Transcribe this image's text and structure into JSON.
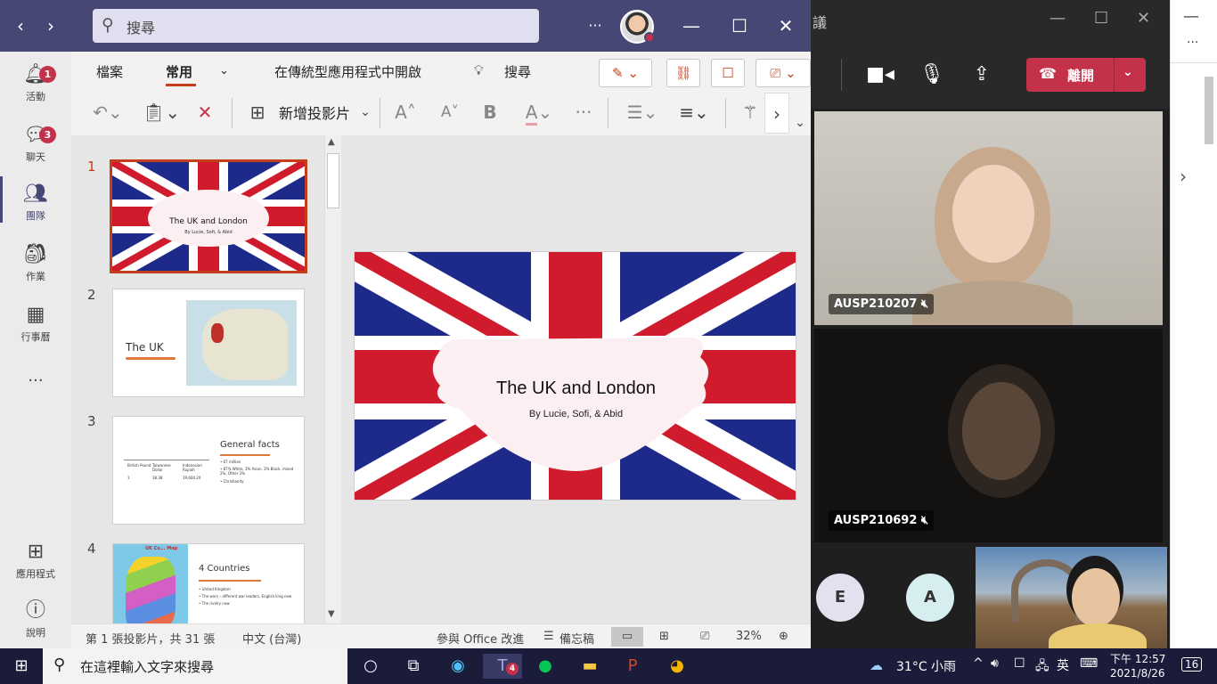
{
  "teams": {
    "search_placeholder": "搜尋",
    "more_label": "···",
    "window": {
      "minimize": "—",
      "maximize": "☐",
      "close": "✕"
    }
  },
  "rail": {
    "items": [
      {
        "id": "activity",
        "label": "活動",
        "icon": "bell-icon",
        "badge": "1"
      },
      {
        "id": "chat",
        "label": "聊天",
        "icon": "chat-icon",
        "badge": "3"
      },
      {
        "id": "teams",
        "label": "團隊",
        "icon": "teams-icon",
        "active": true
      },
      {
        "id": "assignments",
        "label": "作業",
        "icon": "backpack-icon"
      },
      {
        "id": "calendar",
        "label": "行事曆",
        "icon": "calendar-icon"
      },
      {
        "id": "more",
        "label": "···",
        "icon": "ellipsis-icon"
      },
      {
        "id": "apps",
        "label": "應用程式",
        "icon": "apps-icon"
      },
      {
        "id": "help",
        "label": "說明",
        "icon": "help-icon"
      }
    ]
  },
  "ribbon": {
    "tabs": [
      "檔案",
      "常用"
    ],
    "open_desktop": "在傳統型應用程式中開啟",
    "tell_me": "搜尋",
    "new_slide": "新增投影片"
  },
  "slides": {
    "thumb1": {
      "title": "The UK and London",
      "subtitle": "By Lucie, Sofi, & Abid"
    },
    "thumb2": {
      "title": "The UK"
    },
    "thumb3": {
      "title": "General facts",
      "table_headers": [
        "British Pound",
        "Taiwanese Dollar",
        "Indonesian Rupiah"
      ],
      "table_values": [
        "1",
        "38.38",
        "19,600.20"
      ],
      "bullets": [
        "• 67 million",
        "• 87% White, 3% Asian, 3% Black, mixed 2%, Other 3%",
        "• Christianity"
      ]
    },
    "thumb4": {
      "title": "4  Countries",
      "map_label": "UK Co... Map",
      "bullets": [
        "• United Kingdom",
        "• The wars – different war leaders, English king now",
        "• The rivalry now"
      ]
    },
    "numbers": [
      "1",
      "2",
      "3",
      "4"
    ]
  },
  "main_slide": {
    "title": "The UK and London",
    "subtitle": "By Lucie, Sofi, & Abid"
  },
  "statusbar": {
    "slide_count": "第 1 張投影片，共 31 張",
    "language": "中文 (台灣)",
    "feedback": "參與 Office 改進",
    "notes": "備忘稿",
    "zoom": "32%"
  },
  "meeting": {
    "title_char": "議",
    "leave_label": "離開",
    "participants": [
      {
        "name": "AUSP210207"
      },
      {
        "name": "AUSP210692"
      }
    ],
    "avatars": [
      {
        "initial": "E",
        "color": "#e4e0ef"
      },
      {
        "initial": "A",
        "color": "#d6eef0"
      }
    ]
  },
  "taskbar": {
    "search_placeholder": "在這裡輸入文字來搜尋",
    "weather": "31°C  小雨",
    "ime": "英",
    "time": "下午 12:57",
    "date": "2021/8/26",
    "notifications": "16",
    "teams_badge": "4"
  },
  "colors": {
    "teams_purple": "#464775",
    "ppt_accent": "#c43e1c",
    "leave_red": "#c4314b",
    "flag_blue": "#1e2a8a",
    "flag_red": "#cf1b2b"
  }
}
